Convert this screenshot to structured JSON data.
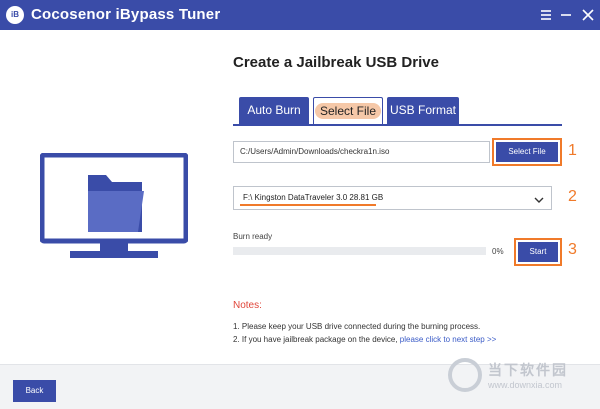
{
  "app": {
    "logo_text": "iB",
    "title": "Cocosenor iBypass Tuner"
  },
  "titlebar": {
    "menu_icon": "hamburger-menu-icon",
    "minimize_icon": "minimize-icon",
    "close_icon": "close-icon"
  },
  "main": {
    "title": "Create a Jailbreak USB Drive"
  },
  "tabs": [
    {
      "label": "Auto Burn",
      "active": false
    },
    {
      "label": "Select File",
      "active": true
    },
    {
      "label": "USB Format",
      "active": false
    }
  ],
  "file": {
    "path": "C:/Users/Admin/Downloads/checkra1n.iso",
    "select_label": "Select File"
  },
  "drive": {
    "selected": "F:\\  Kingston DataTraveler 3.0  28.81 GB"
  },
  "burn": {
    "status": "Burn ready",
    "progress_percent": 0,
    "percent_label": "0%",
    "start_label": "Start"
  },
  "steps": [
    "1",
    "2",
    "3"
  ],
  "notes": {
    "title": "Notes:",
    "line1": "1. Please keep your USB drive connected during the burning process.",
    "line2_prefix": "2. If you have jailbreak package on the device, ",
    "line2_link": "please click to next step >>"
  },
  "footer": {
    "back_label": "Back"
  },
  "watermark": {
    "text_cn": "当下软件园",
    "url": "www.downxia.com"
  },
  "colors": {
    "primary": "#3a4ca8",
    "highlight": "#f07a2a",
    "notes_title": "#e0463a",
    "link": "#3a5bc7"
  }
}
